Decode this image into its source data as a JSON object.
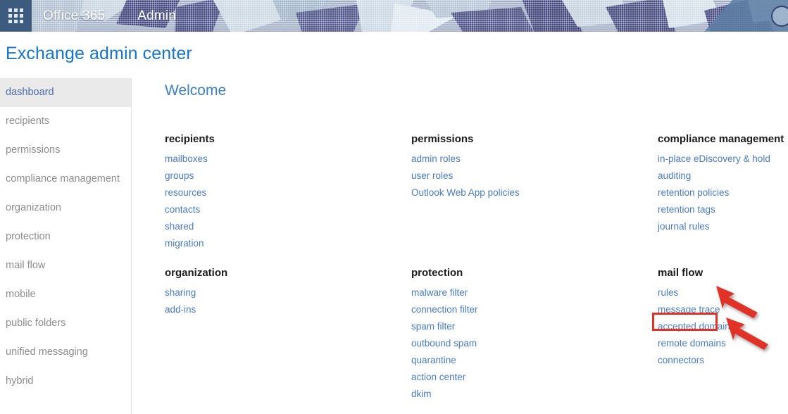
{
  "suite_bar": {
    "waffle_icon": "app-launcher-waffle-icon",
    "brand": "Office 365",
    "app_name": "Admin",
    "help_icon": "help-circle-icon"
  },
  "page": {
    "title": "Exchange admin center",
    "welcome_heading": "Welcome"
  },
  "sidebar": {
    "items": [
      {
        "label": "dashboard",
        "selected": true
      },
      {
        "label": "recipients",
        "selected": false
      },
      {
        "label": "permissions",
        "selected": false
      },
      {
        "label": "compliance management",
        "selected": false
      },
      {
        "label": "organization",
        "selected": false
      },
      {
        "label": "protection",
        "selected": false
      },
      {
        "label": "mail flow",
        "selected": false
      },
      {
        "label": "mobile",
        "selected": false
      },
      {
        "label": "public folders",
        "selected": false
      },
      {
        "label": "unified messaging",
        "selected": false
      },
      {
        "label": "hybrid",
        "selected": false
      }
    ]
  },
  "dashboard": {
    "groups": [
      {
        "title": "recipients",
        "links": [
          "mailboxes",
          "groups",
          "resources",
          "contacts",
          "shared",
          "migration"
        ]
      },
      {
        "title": "permissions",
        "links": [
          "admin roles",
          "user roles",
          "Outlook Web App policies"
        ]
      },
      {
        "title": "compliance management",
        "links": [
          "in-place eDiscovery & hold",
          "auditing",
          "retention policies",
          "retention tags",
          "journal rules"
        ]
      },
      {
        "title": "organization",
        "links": [
          "sharing",
          "add-ins"
        ]
      },
      {
        "title": "protection",
        "links": [
          "malware filter",
          "connection filter",
          "spam filter",
          "outbound spam",
          "quarantine",
          "action center",
          "dkim"
        ]
      },
      {
        "title": "mail flow",
        "links": [
          "rules",
          "message trace",
          "accepted domains",
          "remote domains",
          "connectors"
        ]
      }
    ]
  },
  "annotations": {
    "highlight_color": "#e03228",
    "highlight_target": "message trace",
    "arrows": [
      {
        "name": "annotation-arrow-upper",
        "points_to": "mail flow"
      },
      {
        "name": "annotation-arrow-lower",
        "points_to": "message trace"
      }
    ]
  },
  "colors": {
    "title_blue": "#1874c8",
    "link_blue": "#4a7cc0",
    "welcome_blue": "#3d7ebe",
    "nav_gray": "#8d8d8d",
    "nav_selected_bg": "#eaeaea",
    "waffle_bg": "#3c5b7e",
    "annotation_red": "#e03228"
  }
}
